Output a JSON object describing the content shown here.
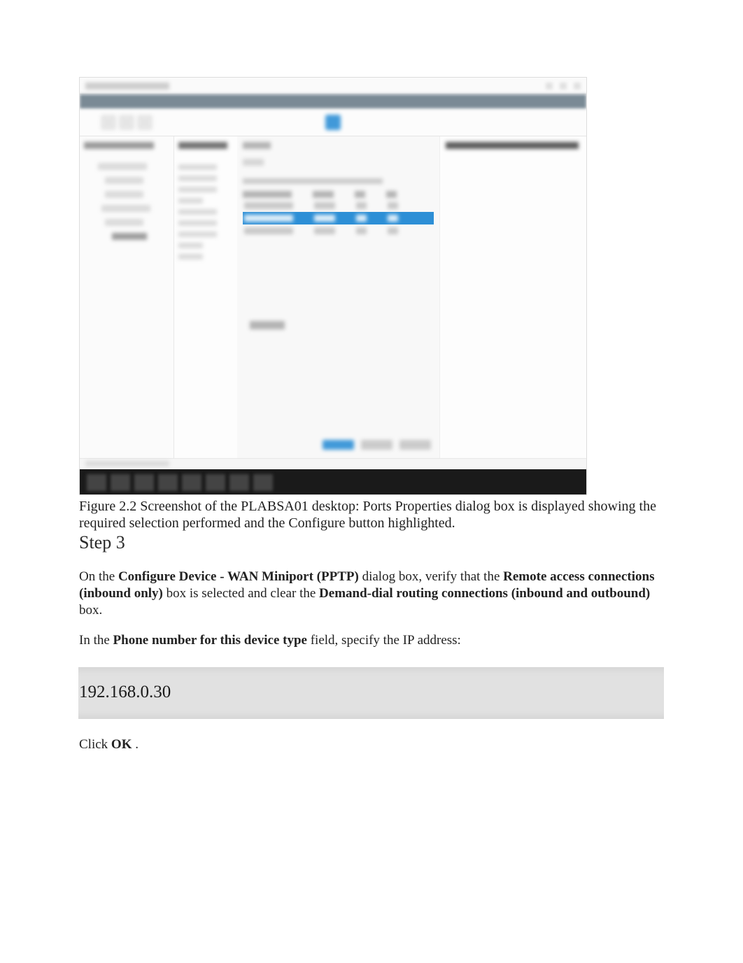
{
  "figure": {
    "caption": "Figure 2.2 Screenshot of the PLABSA01 desktop: Ports Properties dialog box is displayed showing the required selection performed and the Configure button highlighted."
  },
  "step": {
    "heading": "Step 3",
    "para1": {
      "t1": "On the ",
      "b1": "Configure Device - WAN Miniport (PPTP)",
      "t2": " dialog box, verify that the ",
      "b2": "Remote access connections (inbound only)",
      "t3": " box is selected and clear the ",
      "b3": "Demand-dial routing connections (inbound and outbound)",
      "t4": " box."
    },
    "para2": {
      "t1": "In the ",
      "b1": "Phone number for this device type",
      "t2": " field, specify the IP address:"
    },
    "code": "192.168.0.30",
    "para3": {
      "t1": "Click ",
      "b1": "OK",
      "t2": "."
    }
  }
}
